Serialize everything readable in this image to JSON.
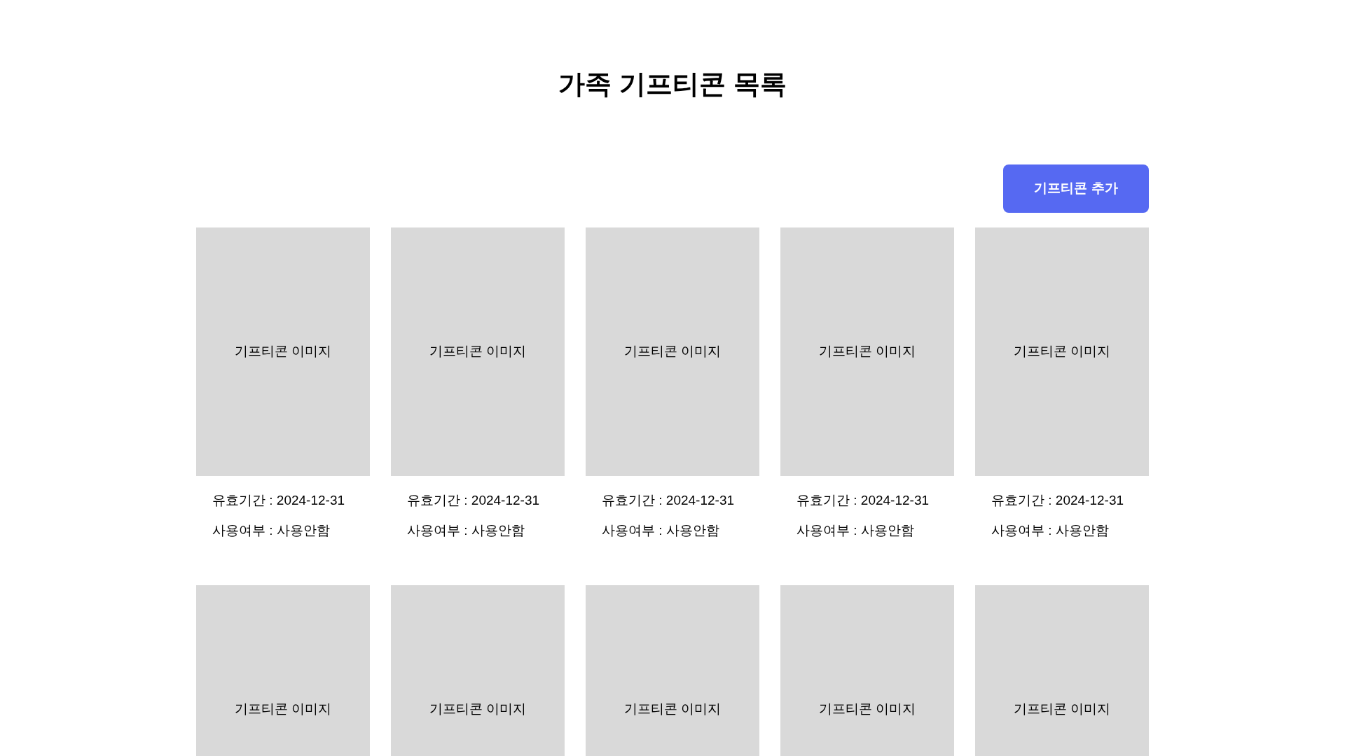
{
  "title": "가족 기프티콘 목록",
  "add_button": "기프티콘 추가",
  "gifticons": [
    {
      "image_label": "기프티콘 이미지",
      "expiry": "유효기간 : 2024-12-31",
      "usage": "사용여부 : 사용안함"
    },
    {
      "image_label": "기프티콘 이미지",
      "expiry": "유효기간 : 2024-12-31",
      "usage": "사용여부 : 사용안함"
    },
    {
      "image_label": "기프티콘 이미지",
      "expiry": "유효기간 : 2024-12-31",
      "usage": "사용여부 : 사용안함"
    },
    {
      "image_label": "기프티콘 이미지",
      "expiry": "유효기간 : 2024-12-31",
      "usage": "사용여부 : 사용안함"
    },
    {
      "image_label": "기프티콘 이미지",
      "expiry": "유효기간 : 2024-12-31",
      "usage": "사용여부 : 사용안함"
    },
    {
      "image_label": "기프티콘 이미지"
    },
    {
      "image_label": "기프티콘 이미지"
    },
    {
      "image_label": "기프티콘 이미지"
    },
    {
      "image_label": "기프티콘 이미지"
    },
    {
      "image_label": "기프티콘 이미지"
    }
  ]
}
